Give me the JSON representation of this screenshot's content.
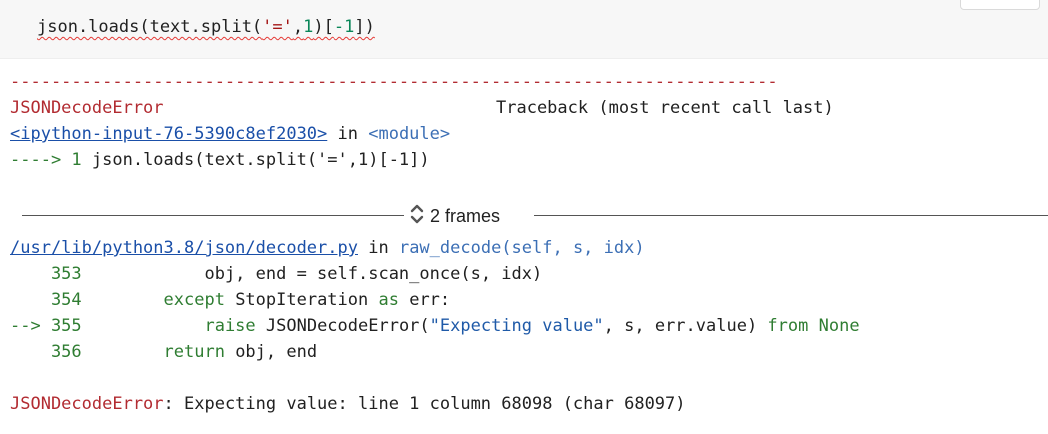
{
  "code_cell": {
    "code_prefix": "json.loads(text.split(",
    "code_str": "'='",
    "code_mid": ",",
    "code_num1": "1",
    "code_mid2": ")[",
    "code_num2": "-1",
    "code_suffix": "])"
  },
  "traceback": {
    "separator": "---------------------------------------------------------------------------",
    "error_name": "JSONDecodeError",
    "header_right": "Traceback (most recent call last)",
    "input_link": "<ipython-input-76-5390c8ef2030>",
    "in_word": " in ",
    "module_name": "<module>",
    "arrow_line_prefix": "----> 1 ",
    "arrow_line_code": "json.loads(text.split('=',1)[-1])",
    "frames_label": "2 frames",
    "file_link": "/usr/lib/python3.8/json/decoder.py",
    "in_word_2": " in ",
    "func_sig": "raw_decode(self, s, idx)",
    "lines": [
      {
        "marker": "    353",
        "code": "            obj, end = self.scan_once(s, idx)"
      },
      {
        "marker": "    354",
        "code_kw": "        except",
        "code_rest": " StopIteration ",
        "code_kw2": "as",
        "code_rest2": " err:"
      },
      {
        "marker": "--> 355",
        "code_kw": "            raise",
        "code_rest": " JSONDecodeError(",
        "code_str": "\"Expecting value\"",
        "code_rest2": ", s, err.value) ",
        "code_kw2": "from",
        "code_kw3": " None"
      },
      {
        "marker": "    356",
        "code_kw": "        return",
        "code_rest": " obj, end"
      }
    ],
    "final_error_name": "JSONDecodeError",
    "final_message": ": Expecting value: line 1 column 68098 (char 68097)"
  },
  "icons": {
    "frames_toggle": "chevron-up-down-icon"
  },
  "colors": {
    "error_red": "#b22b31",
    "link_blue": "#1a4fa8",
    "keyword_green": "#2f7d32"
  }
}
